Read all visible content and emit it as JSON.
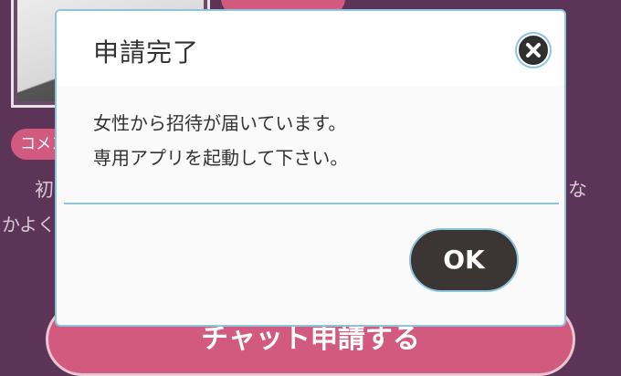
{
  "background": {
    "comment_tag": "コメント",
    "profile_text_line1_start": "初",
    "profile_text_line1_end": "な",
    "profile_text_line2": "かよく",
    "chat_button_label": "チャット申請する"
  },
  "dialog": {
    "title": "申請完了",
    "message_line1": "女性から招待が届いています。",
    "message_line2": "専用アプリを起動して下さい。",
    "ok_label": "OK"
  },
  "colors": {
    "background": "#5b3458",
    "accent_pink": "#d35a7f",
    "dialog_border": "#8ec3de",
    "ok_button": "#3b3633"
  },
  "icons": {
    "close": "close-icon"
  }
}
